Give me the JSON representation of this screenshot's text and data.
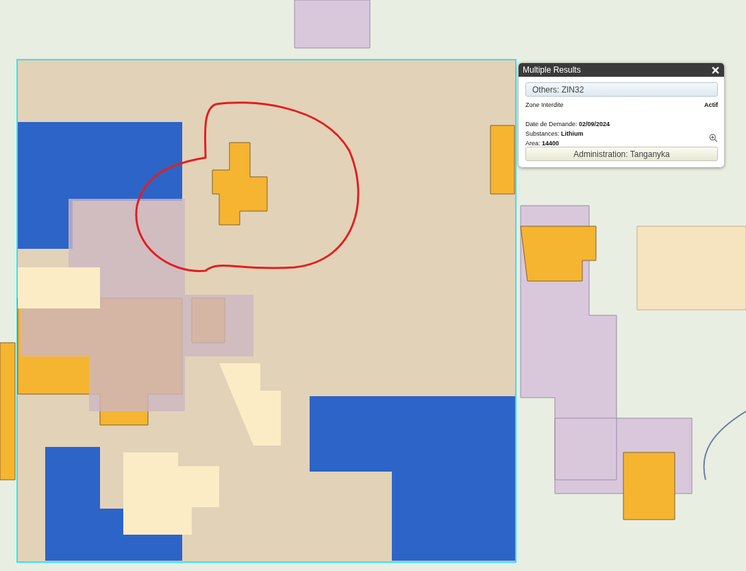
{
  "popup": {
    "title": "Multiple Results",
    "result": "Others: ZIN32",
    "type": "Zone Interdite",
    "status": "Actif",
    "fields": [
      "Date de Demande: **02/09/2024**",
      "Substances: **Lithium**",
      "Area: **14400**"
    ],
    "footer": "Administration: Tanganyka"
  }
}
